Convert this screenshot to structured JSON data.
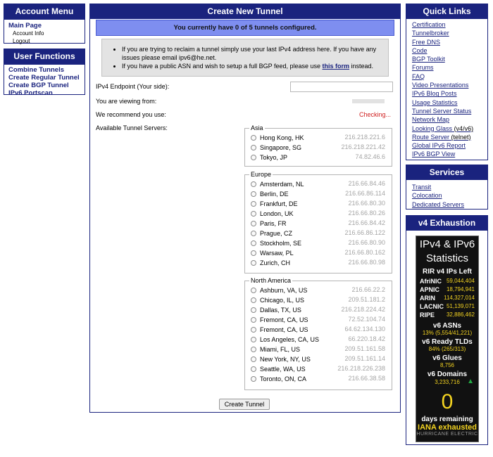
{
  "left": {
    "account_menu": {
      "title": "Account Menu",
      "main_page": "Main Page",
      "items": [
        "Account Info",
        "Logout"
      ]
    },
    "user_functions": {
      "title": "User Functions",
      "items": [
        "Combine Tunnels",
        "Create Regular Tunnel",
        "Create BGP Tunnel",
        "IPv6 Portscan"
      ]
    }
  },
  "main": {
    "title": "Create New Tunnel",
    "tunnel_count_msg": "You currently have 0 of 5 tunnels configured.",
    "info_line1": "If you are trying to reclaim a tunnel simply use your last IPv4 address here. If you have any issues please email ipv6@he.net.",
    "info_line2_pre": "If you have a public ASN and wish to setup a full BGP feed, please use ",
    "info_line2_link": "this form",
    "info_line2_post": " instead.",
    "endpoint_label": "IPv4 Endpoint (Your side):",
    "endpoint_value": "",
    "viewing_label": "You are viewing from:",
    "viewing_value": "",
    "recommend_label": "We recommend you use:",
    "recommend_value": "Checking...",
    "available_label": "Available Tunnel Servers:",
    "regions": [
      {
        "name": "Asia",
        "servers": [
          {
            "name": "Hong Kong, HK",
            "ip": "216.218.221.6"
          },
          {
            "name": "Singapore, SG",
            "ip": "216.218.221.42"
          },
          {
            "name": "Tokyo, JP",
            "ip": "74.82.46.6"
          }
        ]
      },
      {
        "name": "Europe",
        "servers": [
          {
            "name": "Amsterdam, NL",
            "ip": "216.66.84.46"
          },
          {
            "name": "Berlin, DE",
            "ip": "216.66.86.114"
          },
          {
            "name": "Frankfurt, DE",
            "ip": "216.66.80.30"
          },
          {
            "name": "London, UK",
            "ip": "216.66.80.26"
          },
          {
            "name": "Paris, FR",
            "ip": "216.66.84.42"
          },
          {
            "name": "Prague, CZ",
            "ip": "216.66.86.122"
          },
          {
            "name": "Stockholm, SE",
            "ip": "216.66.80.90"
          },
          {
            "name": "Warsaw, PL",
            "ip": "216.66.80.162"
          },
          {
            "name": "Zurich, CH",
            "ip": "216.66.80.98"
          }
        ]
      },
      {
        "name": "North America",
        "servers": [
          {
            "name": "Ashburn, VA, US",
            "ip": "216.66.22.2"
          },
          {
            "name": "Chicago, IL, US",
            "ip": "209.51.181.2"
          },
          {
            "name": "Dallas, TX, US",
            "ip": "216.218.224.42"
          },
          {
            "name": "Fremont, CA, US",
            "ip": "72.52.104.74"
          },
          {
            "name": "Fremont, CA, US",
            "ip": "64.62.134.130"
          },
          {
            "name": "Los Angeles, CA, US",
            "ip": "66.220.18.42"
          },
          {
            "name": "Miami, FL, US",
            "ip": "209.51.161.58"
          },
          {
            "name": "New York, NY, US",
            "ip": "209.51.161.14"
          },
          {
            "name": "Seattle, WA, US",
            "ip": "216.218.226.238"
          },
          {
            "name": "Toronto, ON, CA",
            "ip": "216.66.38.58"
          }
        ]
      }
    ],
    "create_button": "Create Tunnel"
  },
  "right": {
    "quick_links": {
      "title": "Quick Links",
      "items": [
        {
          "label": "Certification"
        },
        {
          "label": "Tunnelbroker"
        },
        {
          "label": "Free DNS"
        },
        {
          "label": "Code"
        },
        {
          "label": "BGP Toolkit"
        },
        {
          "label": "Forums"
        },
        {
          "label": "FAQ"
        },
        {
          "label": "Video Presentations"
        },
        {
          "label": "IPv6 Blog Posts"
        },
        {
          "label": "Usage Statistics"
        },
        {
          "label": "Tunnel Server Status"
        },
        {
          "label": "Network Map"
        },
        {
          "label": "Looking Glass",
          "extra": "(v4/v6)"
        },
        {
          "label": "Route Server",
          "extra": "(telnet)"
        },
        {
          "label": "Global IPv6 Report"
        },
        {
          "label": "IPv6 BGP View"
        }
      ]
    },
    "services": {
      "title": "Services",
      "items": [
        "Transit",
        "Colocation",
        "Dedicated Servers"
      ]
    },
    "v4_exhaustion": {
      "title": "v4 Exhaustion",
      "stats_title_1": "IPv4 & IPv6",
      "stats_title_2": "Statistics",
      "rir_header": "RIR v4 IPs Left",
      "rirs": [
        {
          "name": "AfriNIC",
          "value": "59,044,404"
        },
        {
          "name": "APNIC",
          "value": "18,794,941"
        },
        {
          "name": "ARIN",
          "value": "114,327,014"
        },
        {
          "name": "LACNIC",
          "value": "51,139,071"
        },
        {
          "name": "RIPE",
          "value": "32,886,462"
        }
      ],
      "v6_asns_label": "v6 ASNs",
      "v6_asns_value": "13% (5,554/41,221)",
      "v6_tlds_label": "v6 Ready TLDs",
      "v6_tlds_value": "84% (265/313)",
      "v6_glues_label": "v6 Glues",
      "v6_glues_value": "8,756",
      "v6_domains_label": "v6 Domains",
      "v6_domains_value": "3,233,716",
      "days_value": "0",
      "days_label": "days remaining",
      "iana_label": "IANA exhausted",
      "footer": "HURRICANE ELECTRIC",
      "colors": {
        "accent": "#f3d321",
        "trend_up": "#22aa44"
      }
    }
  },
  "colors": {
    "navy": "#1a237e",
    "banner": "#7e8ef0",
    "checking": "#d02020"
  }
}
